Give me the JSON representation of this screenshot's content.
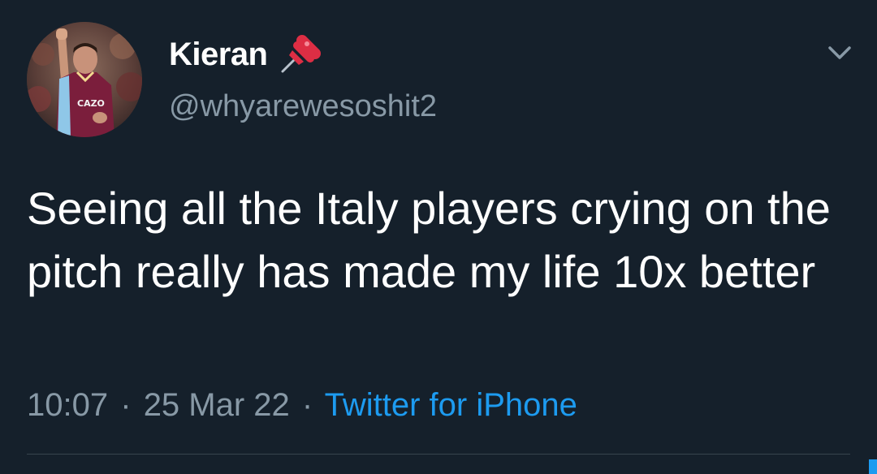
{
  "tweet": {
    "display_name": "Kieran",
    "name_emoji": "pushpin-icon",
    "handle": "@whyarewesoshit2",
    "text": "Seeing all the Italy players crying on the pitch really has made my life 10x better",
    "time": "10:07",
    "separator": "·",
    "date": "25 Mar 22",
    "source": "Twitter for iPhone",
    "avatar_shirt_text": "CAZO"
  },
  "colors": {
    "background": "#15202b",
    "primary_text": "#ffffff",
    "secondary_text": "#8899a6",
    "link": "#1d9bf0",
    "divider": "#38444d",
    "pin_red": "#dd2e44"
  },
  "icons": {
    "menu": "chevron-down-icon",
    "avatar": "avatar"
  }
}
